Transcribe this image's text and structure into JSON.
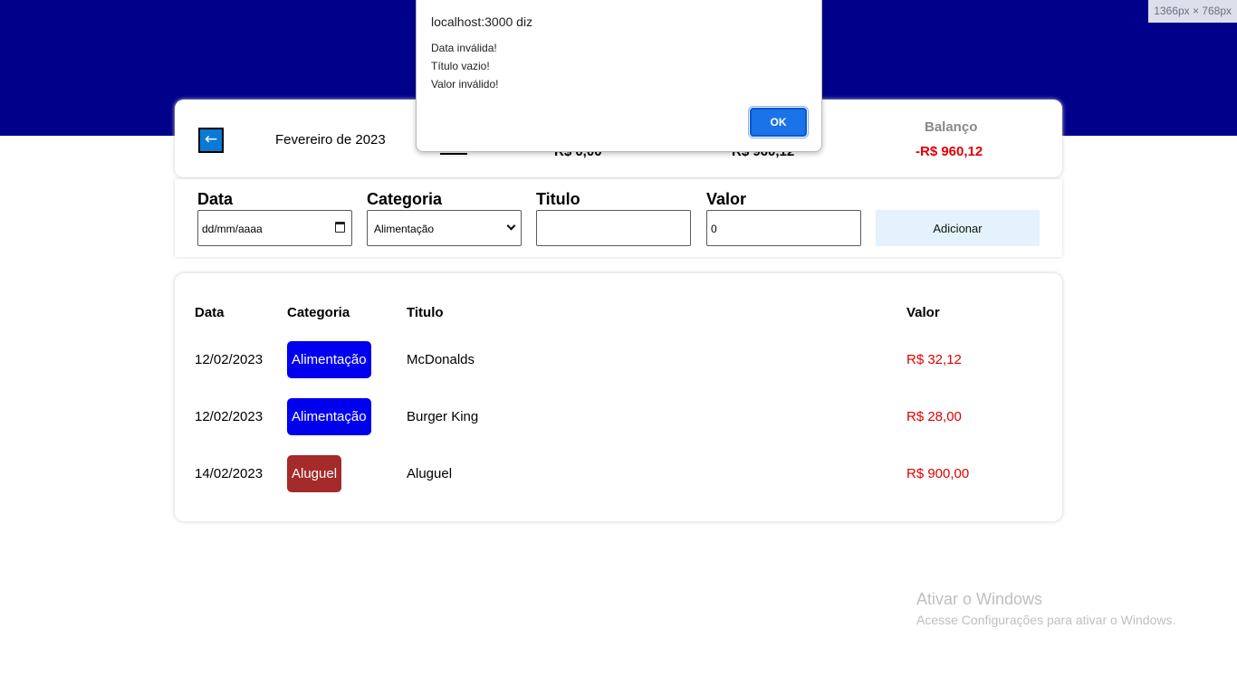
{
  "viewport_indicator": "1366px × 768px",
  "summary": {
    "back_symbol": "←",
    "month": "Fevereiro de 2023",
    "receita_value": "R$ 0,00",
    "despesa_value": "R$ 960,12",
    "balance_title": "Balanço",
    "balance_value": "-R$ 960,12"
  },
  "form": {
    "date_label": "Data",
    "date_placeholder": "dd/mm/aaaa",
    "category_label": "Categoria",
    "category_selected": "Alimentação",
    "title_label": "Titulo",
    "title_value": "",
    "value_label": "Valor",
    "value_value": "0",
    "add_button": "Adicionar"
  },
  "table": {
    "headers": [
      "Data",
      "Categoria",
      "Titulo",
      "Valor"
    ],
    "rows": [
      {
        "date": "12/02/2023",
        "category": "Alimentação",
        "category_color": "#0000ee",
        "title": "McDonalds",
        "value": "R$ 32,12"
      },
      {
        "date": "12/02/2023",
        "category": "Alimentação",
        "category_color": "#0000ee",
        "title": "Burger King",
        "value": "R$ 28,00"
      },
      {
        "date": "14/02/2023",
        "category": "Aluguel",
        "category_color": "#a52a2a",
        "title": "Aluguel",
        "value": "R$ 900,00"
      }
    ]
  },
  "alert": {
    "title": "localhost:3000 diz",
    "messages": [
      "Data inválida!",
      "Título vazio!",
      "Valor inválido!"
    ],
    "ok_button": "OK"
  },
  "watermark": {
    "title": "Ativar o Windows",
    "subtitle": "Acesse Configurações para ativar o Windows."
  },
  "colors": {
    "header_band": "#00008b",
    "negative": "#e00000",
    "accent": "#1a73e8"
  }
}
